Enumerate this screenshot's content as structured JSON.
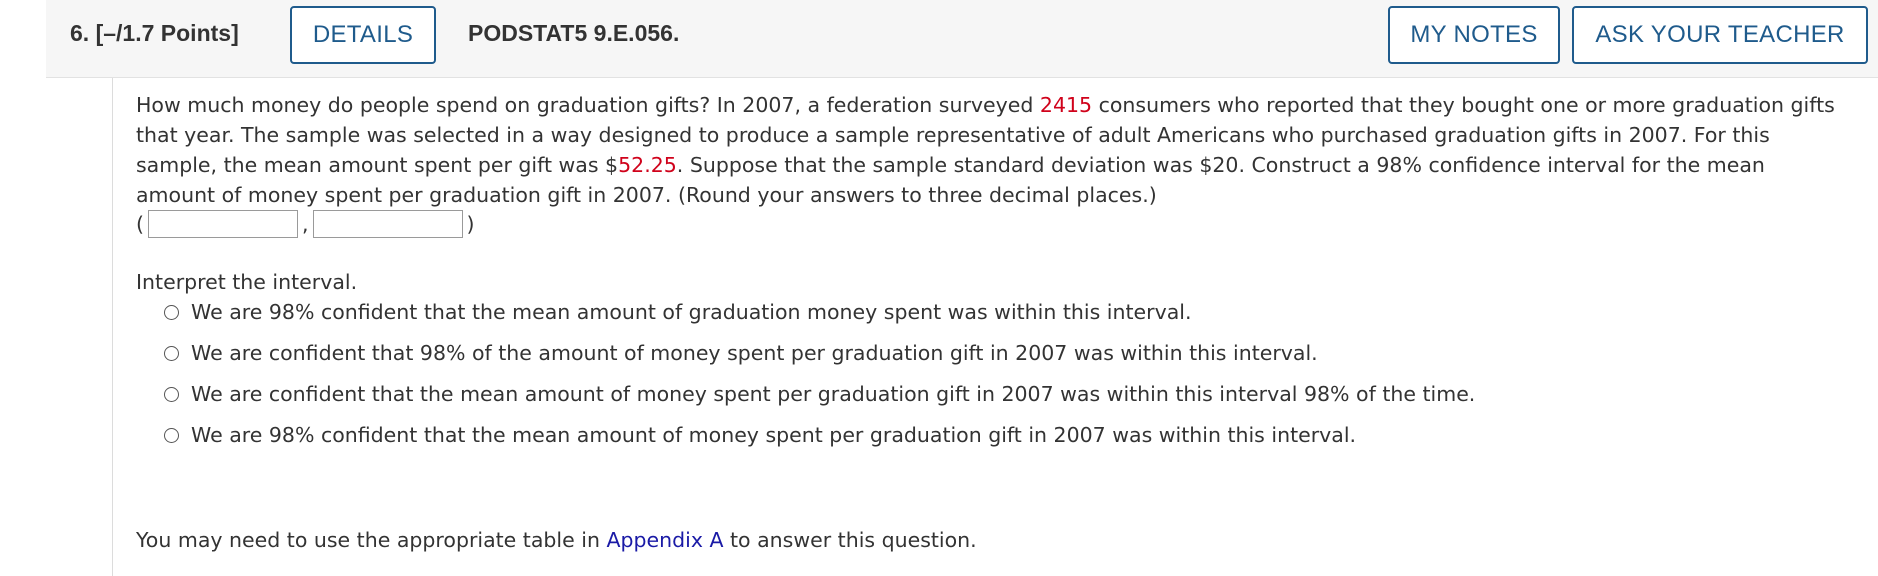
{
  "header": {
    "question_number": "6.",
    "points": "[–/1.7 Points]",
    "details_label": "DETAILS",
    "code": "PODSTAT5 9.E.056.",
    "my_notes_label": "MY NOTES",
    "ask_teacher_label": "ASK YOUR TEACHER"
  },
  "question": {
    "part1": "How much money do people spend on graduation gifts? In 2007, a federation surveyed ",
    "highlight1": "2415",
    "part2": " consumers who reported that they bought one or more graduation gifts that year. The sample was selected in a way designed to produce a sample representative of adult Americans who purchased graduation gifts in 2007. For this sample, the mean amount spent per gift was $",
    "highlight2": "52.25",
    "part3": ". Suppose that the sample standard deviation was $20. Construct a 98% confidence interval for the mean amount of money spent per graduation gift in 2007. (Round your answers to three decimal places.)"
  },
  "interval": {
    "open": "(",
    "separator": ",",
    "close": ")",
    "lower_value": "",
    "upper_value": ""
  },
  "interpret_label": "Interpret the interval.",
  "options": [
    "We are 98% confident that the mean amount of graduation money spent was within this interval.",
    "We are confident that 98% of the amount of money spent per graduation gift in 2007 was within this interval.",
    "We are confident that the mean amount of money spent per graduation gift in 2007 was within this interval 98% of the time.",
    "We are 98% confident that the mean amount of money spent per graduation gift in 2007 was within this interval."
  ],
  "footer": {
    "prefix": "You may need to use the appropriate table in ",
    "link": "Appendix A",
    "suffix": " to answer this question."
  },
  "colors": {
    "button_border": "#1f5b8c",
    "highlight": "#d0021b",
    "link": "#1a1aa6"
  }
}
